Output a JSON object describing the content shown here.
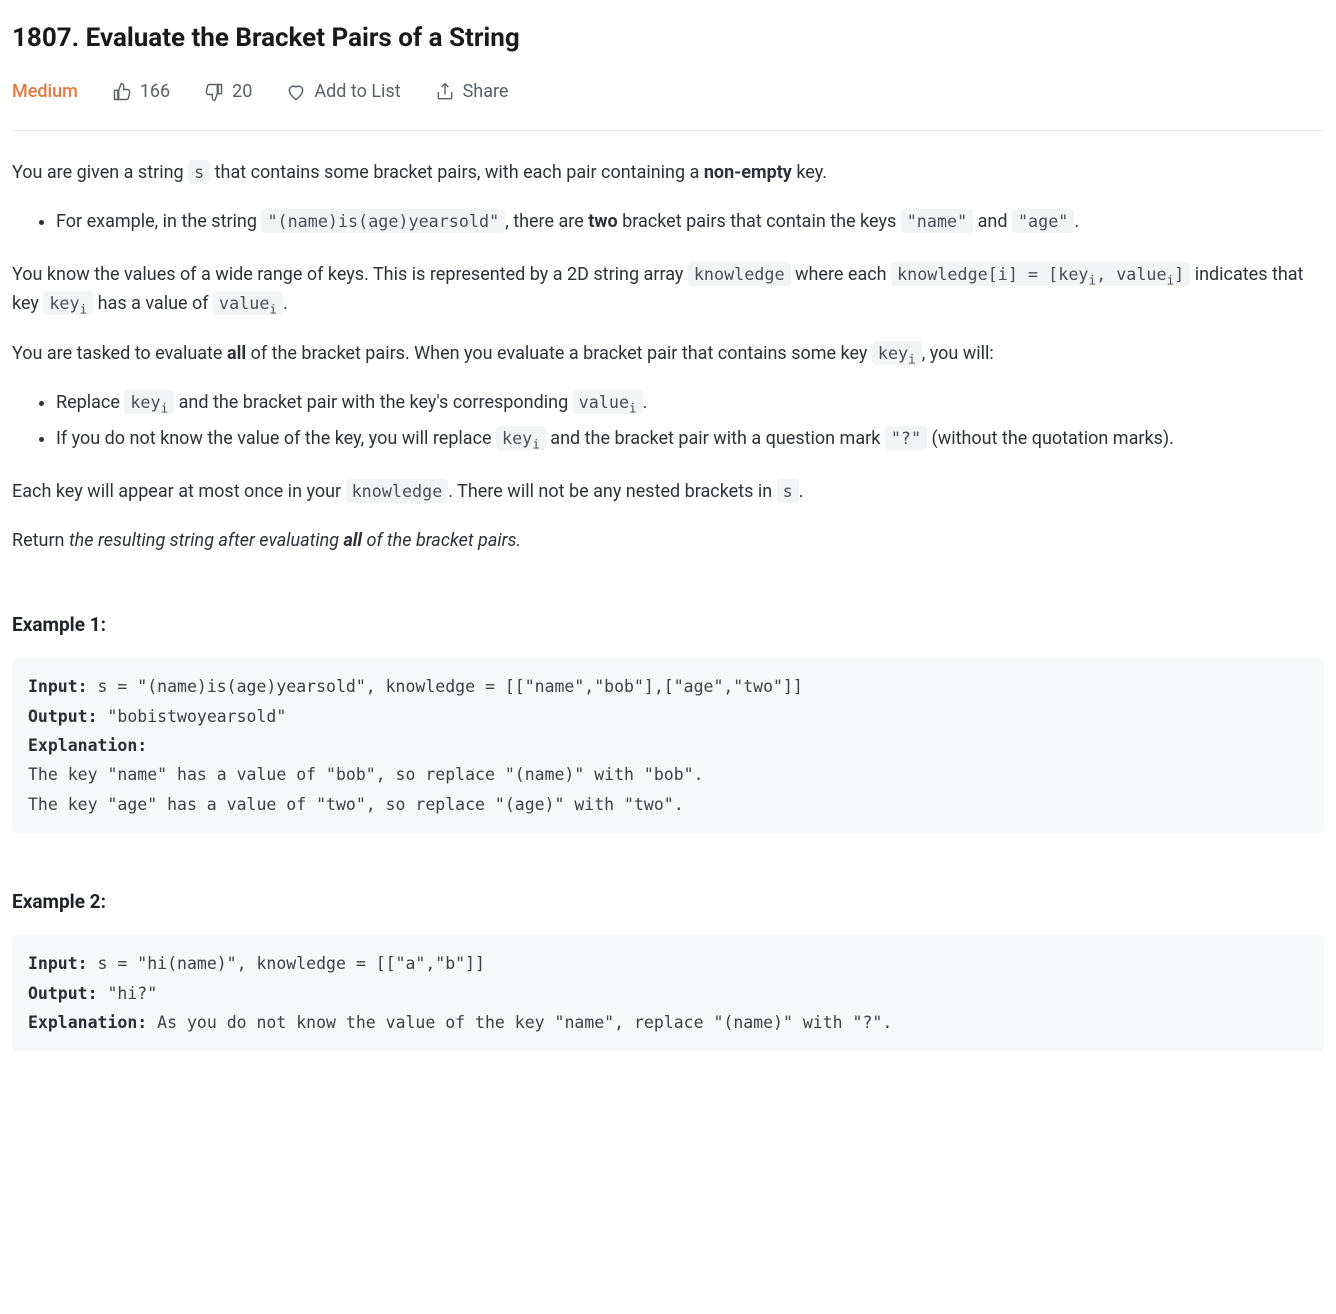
{
  "title": "1807. Evaluate the Bracket Pairs of a String",
  "meta": {
    "difficulty": "Medium",
    "likes": "166",
    "dislikes": "20",
    "add_to_list": "Add to List",
    "share": "Share"
  },
  "body": {
    "p1_a": "You are given a string ",
    "p1_code_s": "s",
    "p1_b": " that contains some bracket pairs, with each pair containing a ",
    "p1_bold": "non-empty",
    "p1_c": " key.",
    "li1_a": "For example, in the string ",
    "li1_code1": "\"(name)is(age)yearsold\"",
    "li1_b": ", there are ",
    "li1_bold": "two",
    "li1_c": " bracket pairs that contain the keys ",
    "li1_code2": "\"name\"",
    "li1_d": " and ",
    "li1_code3": "\"age\"",
    "li1_e": ".",
    "p2_a": "You know the values of a wide range of keys. This is represented by a 2D string array ",
    "p2_code1": "knowledge",
    "p2_b": " where each ",
    "p2_code2_a": "knowledge[i] = [key",
    "p2_code2_b": ", value",
    "p2_code2_c": "]",
    "p2_c": " indicates that key ",
    "p2_code3": "key",
    "p2_d": " has a value of ",
    "p2_code4": "value",
    "p2_e": ".",
    "p3_a": "You are tasked to evaluate ",
    "p3_bold": "all",
    "p3_b": " of the bracket pairs. When you evaluate a bracket pair that contains some key ",
    "p3_code": "key",
    "p3_c": ", you will:",
    "li2_a": "Replace ",
    "li2_code1": "key",
    "li2_b": " and the bracket pair with the key's corresponding ",
    "li2_code2": "value",
    "li2_c": ".",
    "li3_a": "If you do not know the value of the key, you will replace ",
    "li3_code1": "key",
    "li3_b": " and the bracket pair with a question mark ",
    "li3_code2": "\"?\"",
    "li3_c": " (without the quotation marks).",
    "p4_a": "Each key will appear at most once in your ",
    "p4_code1": "knowledge",
    "p4_b": ". There will not be any nested brackets in ",
    "p4_code2": "s",
    "p4_c": ".",
    "p5_a": "Return ",
    "p5_em_a": "the resulting string after evaluating ",
    "p5_em_bold": "all",
    "p5_em_b": " of the bracket pairs."
  },
  "labels": {
    "input": "Input:",
    "output": "Output:",
    "explanation": "Explanation:"
  },
  "ex1": {
    "heading": "Example 1:",
    "input": " s = \"(name)is(age)yearsold\", knowledge = [[\"name\",\"bob\"],[\"age\",\"two\"]]",
    "output": " \"bobistwoyearsold\"",
    "explanation": "\nThe key \"name\" has a value of \"bob\", so replace \"(name)\" with \"bob\".\nThe key \"age\" has a value of \"two\", so replace \"(age)\" with \"two\"."
  },
  "ex2": {
    "heading": "Example 2:",
    "input": " s = \"hi(name)\", knowledge = [[\"a\",\"b\"]]",
    "output": " \"hi?\"",
    "explanation": " As you do not know the value of the key \"name\", replace \"(name)\" with \"?\"."
  },
  "sub_i": "i"
}
